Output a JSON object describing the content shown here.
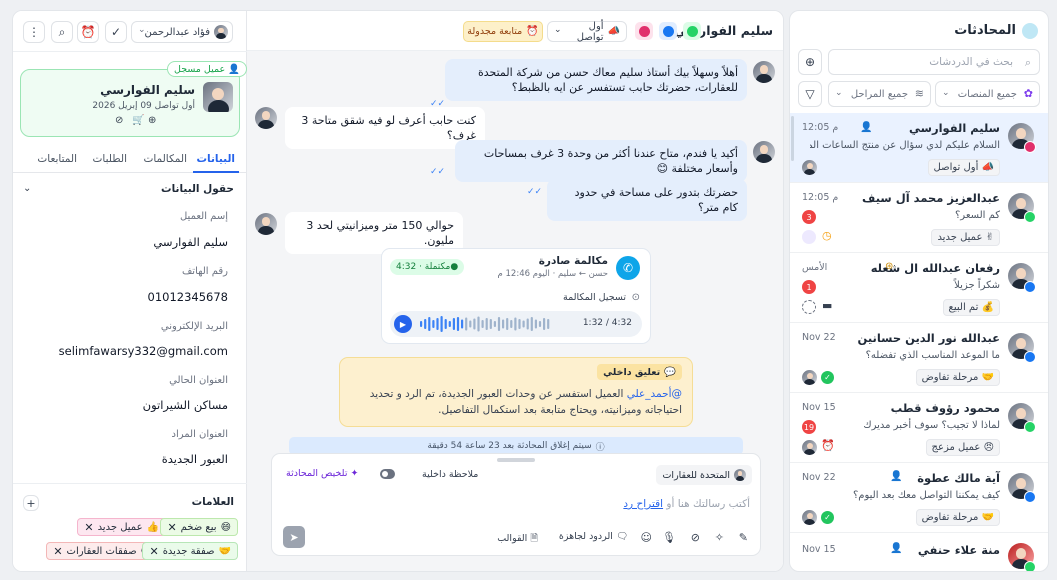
{
  "convs": {
    "title": "المحادثات",
    "search_placeholder": "بحث في الدردشات",
    "filter_platforms": "جميع المنصات",
    "filter_stages": "جميع المراحل",
    "items": [
      {
        "name": "سليم الفوارسي",
        "time": "12:05 م",
        "preview": "السلام عليكم لدي سؤال عن منتج الساعات الم...",
        "tag": "أول تواصل",
        "channel": "instagram"
      },
      {
        "name": "عبدالعزيز محمد آل سيف",
        "time": "12:05 م",
        "preview": "كم السعر؟",
        "tag": "عميل جديد",
        "count": "3",
        "channel": "whatsapp"
      },
      {
        "name": "رفعان عبدالله ال شعله",
        "time": "الأمس",
        "preview": "شكراً جزيلاً",
        "tag": "تم البيع",
        "count": "1",
        "channel": "messenger"
      },
      {
        "name": "عبدالله نور الدين حسانين",
        "time": "Nov 22",
        "preview": "ما الموعد المناسب الذي تفضله؟",
        "tag": "مرحلة تفاوض",
        "channel": "messenger"
      },
      {
        "name": "محمود رؤوف قطب",
        "time": "Nov 15",
        "preview": "لماذا لا تجيب؟ سوف أخبر مديرك",
        "tag": "عميل مزعج",
        "count": "19",
        "channel": "whatsapp"
      },
      {
        "name": "آية مالك عطوة",
        "time": "Nov 22",
        "preview": "كيف يمكننا التواصل معك بعد اليوم؟",
        "tag": "مرحلة تفاوض",
        "channel": "messenger"
      },
      {
        "name": "منة علاء حنفي",
        "time": "Nov 15",
        "preview": "",
        "tag": "",
        "channel": "whatsapp"
      }
    ]
  },
  "header": {
    "contact_name": "سليم الفوارسي",
    "stage_label": "أول تواصل",
    "followup_label": "متابعة مجدولة",
    "agent_name": "فؤاد عبدالرحمن"
  },
  "messages": {
    "m1": "أهلاً وسهلاً بيك أستاذ سليم معاك حسن من شركة المتحدة للعقارات، حضرتك حابب تستفسر عن ايه بالظبط؟",
    "m2": "كنت حابب أعرف لو فيه شقق متاحة 3 غرف؟",
    "m3": "أكيد يا فندم، متاح عندنا أكثر من وحدة 3 غرف بمساحات وأسعار مختلفة",
    "m3_emoji": "😊",
    "m4": "حضرتك بتدور على مساحة في حدود كام متر؟",
    "m5": "حوالي 150 متر وميزانيتي لحد 3 مليون.",
    "call_title": "مكالمة صادرة",
    "call_meta": "حسن ← سليم · اليوم 12:46 م",
    "call_status": "مكتملة · 4:32",
    "call_record_label": "تسجيل المكالمة",
    "call_progress": "1:32 / 4:32",
    "note_title": "تعليق داخلي",
    "note_mention": "@أحمد_علي",
    "note_text": "العميل استفسر عن وحدات العبور الجديدة، تم الرد و تحديد احتياجاته وميزانيته، ويحتاج متابعة بعد استكمال التفاصيل.",
    "close_notice": "سيتم إغلاق المحادثة بعد 23 ساعة 54 دقيقة"
  },
  "composer": {
    "inbox": "المتحدة للعقارات",
    "internal_note": "ملاحظة داخلية",
    "summarize": "تلخيص المحادثة",
    "placeholder_prefix": "أكتب رسالتك هنا أو",
    "suggest_link": "اقتراح رد",
    "canned": "الردود لجاهزة",
    "templates": "القوالب"
  },
  "contact": {
    "badge": "عميل مسجل",
    "name": "سليم الفوارسي",
    "first_contact": "أول تواصل 09 إبريل 2026",
    "tabs": [
      "البيانات",
      "المكالمات",
      "الطلبات",
      "المتابعات"
    ],
    "section_title": "حقول البيانات",
    "fields": [
      {
        "label": "إسم العميل",
        "value": "سليم الفوارسي"
      },
      {
        "label": "رقم الهاتف",
        "value": "01012345678"
      },
      {
        "label": "البريد الإلكتروني",
        "value": "selimfawarsy332@gmail.com"
      },
      {
        "label": "العنوان الحالي",
        "value": "مساكن الشيراتون"
      },
      {
        "label": "العنوان المراد",
        "value": "العبور الجديدة"
      }
    ],
    "tags_title": "العلامات",
    "tags": [
      {
        "label": "عميل جديد",
        "emoji": "👍",
        "bg": "#fde7f0",
        "border": "#f5b5cd"
      },
      {
        "label": "بيع ضخم",
        "emoji": "😄",
        "bg": "#ecfbe6",
        "border": "#bde8ad"
      },
      {
        "label": "صفقات العقارات",
        "emoji": "😘",
        "bg": "#fdecec",
        "border": "#f3b7b7"
      },
      {
        "label": "صفقة جديدة",
        "emoji": "🤝",
        "bg": "#eafbea",
        "border": "#b7e6b7"
      }
    ]
  },
  "colors": {
    "accent": "#2563eb",
    "green": "#22c55e",
    "note": "#fdf0cf"
  }
}
